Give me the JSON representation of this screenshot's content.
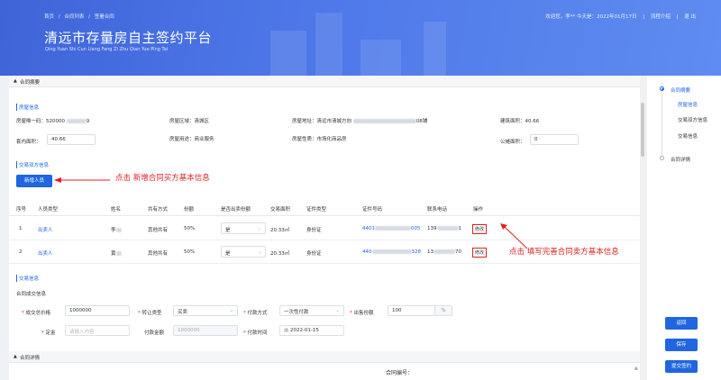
{
  "header": {
    "breadcrumb": [
      "首页",
      "/",
      "合同列表",
      "/",
      "签署合同"
    ],
    "title": "清远市存量房自主签约平台",
    "subtitle": "Qing Yuan Shi Cun Liang Fang Zi Zhu Qian Yue Ping Tai",
    "welcome": "欢迎您，李** 今天是：2022年01月17日",
    "sep": "|",
    "flow": "流程介绍",
    "logout": "退 出"
  },
  "sections": {
    "contract_summary": "合同摘要",
    "contract_details": "合同详情",
    "collapse_icon": "caret-up-icon"
  },
  "house": {
    "heading": "房屋信息",
    "code_label": "房屋唯一码：",
    "code_value": "520000",
    "code_suffix": "9",
    "area_label": "房屋区域：",
    "area_value": "清城区",
    "addr_label": "房屋地址：",
    "addr_prefix": "清远市清城方向",
    "addr_suffix": "08铺",
    "build_area_label": "建筑面积：",
    "build_area_value": "40.66",
    "inner_area_label": "套内面积：",
    "inner_area_value": "40.66",
    "use_label": "房屋用途：",
    "use_value": "商业服务",
    "nature_label": "房屋性质：",
    "nature_value": "市场化商品房",
    "share_area_label": "公摊面积：",
    "share_area_value": "0"
  },
  "parties": {
    "heading": "交易双方信息",
    "add_button": "新增人员",
    "annotation_add": "点击 新增合同买方基本信息",
    "annotation_edit": "点击 填写完善合同卖方基本信息",
    "columns": [
      "序号",
      "人员类型",
      "姓名",
      "共有方式",
      "份额",
      "是否出卖份额",
      "交易面积",
      "证件类型",
      "证件号码",
      "联系电话",
      "操作"
    ],
    "rows": [
      {
        "no": "1",
        "type": "出卖人",
        "name": "李",
        "share_mode": "其他共有",
        "share": "50%",
        "sell_share": "是",
        "area": "20.33㎡",
        "id_type": "身份证",
        "id_prefix": "4401",
        "id_suffix": "005",
        "phone_prefix": "139",
        "phone_suffix": "1",
        "action": "修改"
      },
      {
        "no": "2",
        "type": "出卖人",
        "name": "黄",
        "share_mode": "其他共有",
        "share": "50%",
        "sell_share": "是",
        "area": "20.33㎡",
        "id_type": "身份证",
        "id_prefix": "440",
        "id_suffix": "328",
        "phone_prefix": "13",
        "phone_suffix": "70",
        "action": "修改"
      }
    ]
  },
  "deal": {
    "heading": "交易信息",
    "subheading": "合同成交信息",
    "price_label": "成交总价格",
    "price_value": "1000000",
    "transfer_label": "转让类型",
    "transfer_value": "买卖",
    "pay_label": "付款方式",
    "pay_value": "一次性付款",
    "ratio_label": "出售份额",
    "ratio_value": "100",
    "ratio_unit": "%",
    "deposit_label": "定金",
    "deposit_placeholder": "请输入内容",
    "pay_amount_label": "付款金额",
    "pay_amount_value": "1000000",
    "pay_time_label": "付款时间",
    "pay_time_value": "2022-01-15",
    "required": "*"
  },
  "contract_no_label": "合同编号：",
  "rightnav": {
    "items": [
      "合同摘要",
      "房屋信息",
      "交易双方信息",
      "交易信息",
      "合同详情"
    ]
  },
  "side_buttons": {
    "back": "返回",
    "save": "保存",
    "submit": "提交签约"
  },
  "colors": {
    "primary": "#1f66e0",
    "annotation": "#e02020"
  }
}
